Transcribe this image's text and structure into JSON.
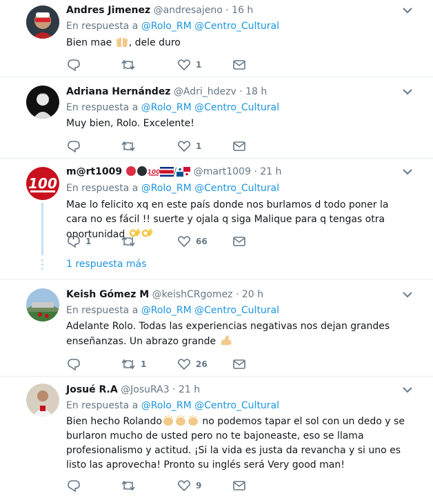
{
  "tweets": [
    {
      "name": "Andres Jimenez",
      "handle": "@andresajeno",
      "time": "· 16 h",
      "reply_prefix": "En respuesta a",
      "mention1": "@Rolo_RM",
      "mention2": "@Centro_Cultural",
      "text_a": "Bien mae ",
      "text_b": ", dele duro",
      "replies": "",
      "retweets": "",
      "likes": "1"
    },
    {
      "name": "Adriana Hernández",
      "handle": "@Adri_hdezv",
      "time": "· 18 h",
      "reply_prefix": "En respuesta a",
      "mention1": "@Rolo_RM",
      "mention2": "@Centro_Cultural",
      "text": "Muy bien, Rolo. Excelente!",
      "replies": "",
      "retweets": "",
      "likes": "1"
    },
    {
      "name": "m@rt1009",
      "handle": "@mart1009",
      "time": "· 21 h",
      "reply_prefix": "En respuesta a",
      "mention1": "@Rolo_RM",
      "mention2": "@Centro_Cultural",
      "text": "Mae lo felicito xq en este país donde nos burlamos d todo poner la cara no es fácil !! suerte y ojala q siga Malique para q tengas otra oportunidad ",
      "replies": "1",
      "retweets": "",
      "likes": "66",
      "more_replies": "1 respuesta más"
    },
    {
      "name": "Keish Gómez M",
      "handle": "@keishCRgomez",
      "time": "· 20 h",
      "reply_prefix": "En respuesta a",
      "mention1": "@Rolo_RM",
      "mention2": "@Centro_Cultural",
      "text": "Adelante Rolo. Todas las experiencias negativas nos dejan grandes enseñanzas. Un abrazo grande ",
      "replies": "",
      "retweets": "1",
      "likes": "26"
    },
    {
      "name": "Josué R.A",
      "handle": "@JosuRA3",
      "time": "· 21 h",
      "reply_prefix": "En respuesta a",
      "mention1": "@Rolo_RM",
      "mention2": "@Centro_Cultural",
      "text_a": "Bien hecho Rolando",
      "text_b": " no podemos tapar el sol con un dedo y se burlaron mucho de usted pero no te bajoneaste, eso se llama profesionalismo y actitud. ¡Si la vida es justa da revancha y si uno es listo las aprovecha! Pronto su inglés será Very good man!",
      "replies": "",
      "retweets": "",
      "likes": "9"
    }
  ],
  "colors": {
    "accent": "#1b95e0",
    "muted": "#657786",
    "border": "#e6ecf0",
    "thread": "#c4e2f5"
  },
  "icons": [
    "reply-icon",
    "retweet-icon",
    "heart-icon",
    "dm-icon",
    "chevron-down-icon"
  ]
}
